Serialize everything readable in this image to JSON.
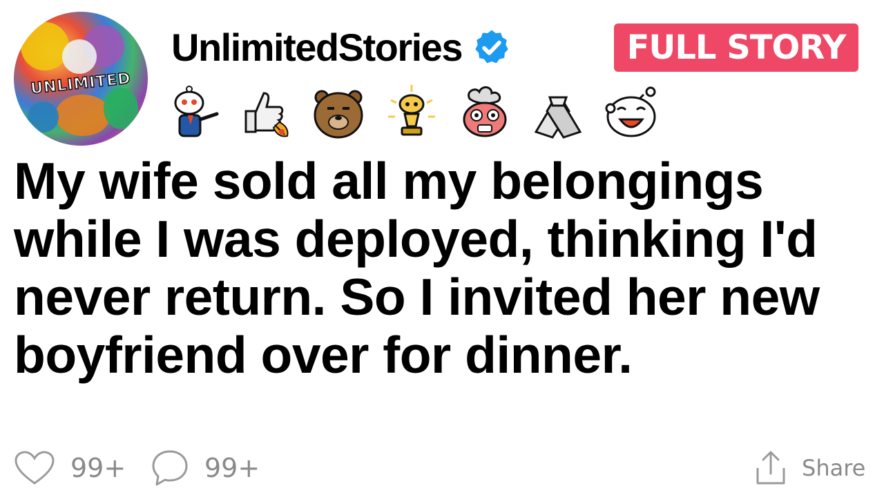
{
  "header": {
    "avatar_label": "UNLIMITED",
    "username": "UnlimitedStories",
    "verified_icon": "verified-check-icon",
    "badge_label": "FULL STORY",
    "badge_color": "#ee4866",
    "verified_color": "#1d9bf0"
  },
  "awards": [
    {
      "icon": "snoo-pointing-award-icon"
    },
    {
      "icon": "thumbs-up-rocket-award-icon"
    },
    {
      "icon": "bear-award-icon"
    },
    {
      "icon": "gold-trophy-award-icon"
    },
    {
      "icon": "mind-blown-award-icon"
    },
    {
      "icon": "handshake-award-icon"
    },
    {
      "icon": "laughing-snoo-award-icon"
    }
  ],
  "post": {
    "title": "My wife sold all my belongings while I was deployed, thinking I'd never return. So I invited her new boyfriend over for dinner."
  },
  "footer": {
    "likes": "99+",
    "comments": "99+",
    "share_label": "Share",
    "icon_color": "#9a9a9a"
  }
}
